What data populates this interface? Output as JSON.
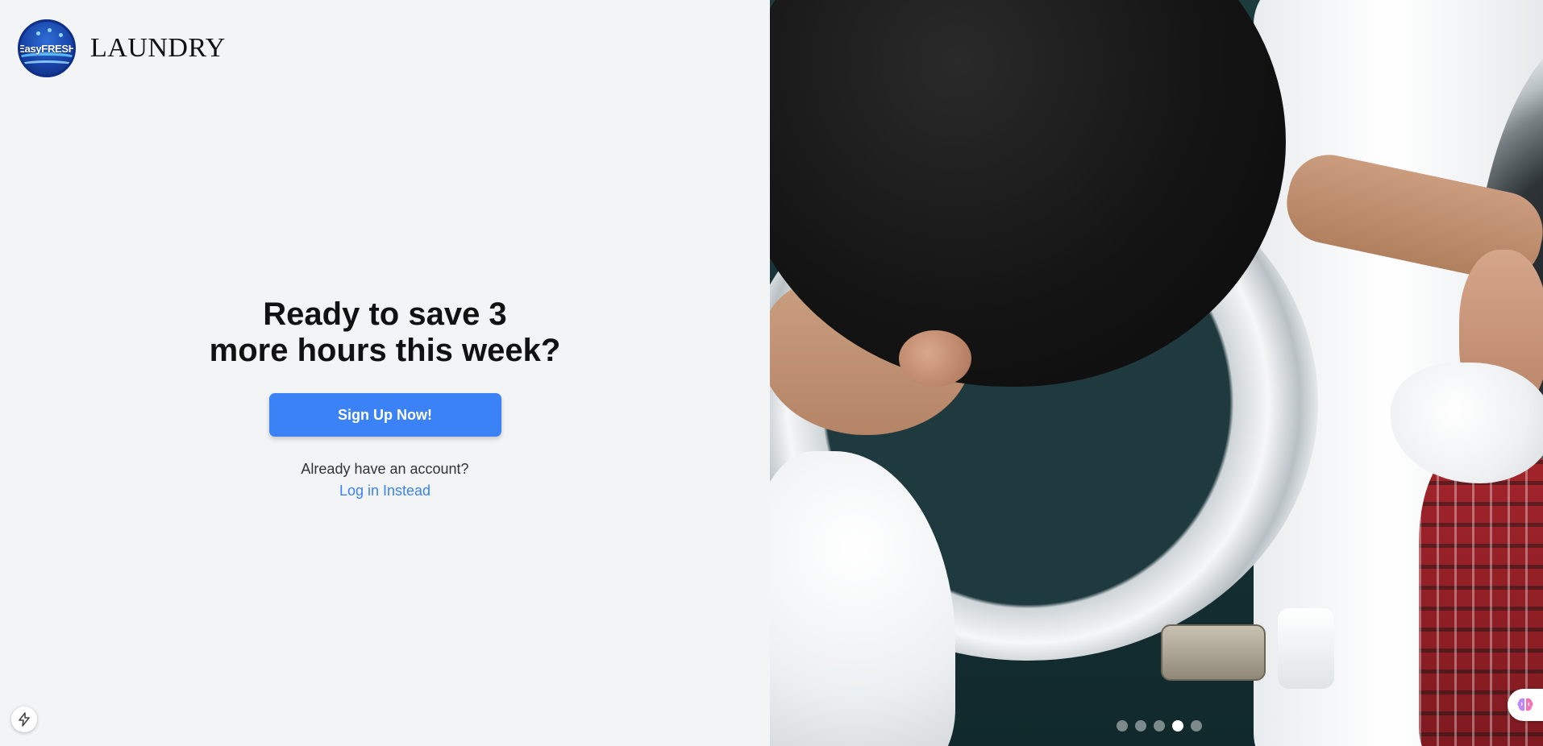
{
  "brand": {
    "badge_text": "EasyFRESH",
    "name": "LAUNDRY"
  },
  "hero": {
    "headline_line1": "Ready to save 3",
    "headline_line2": "more hours this week?",
    "cta_label": "Sign Up Now!",
    "already_text": "Already have an account?",
    "login_label": "Log in Instead"
  },
  "carousel": {
    "slide_count": 5,
    "active_index": 3
  },
  "icons": {
    "bottom_left": "lightning-bolt-icon",
    "bottom_right": "brain-icon"
  },
  "colors": {
    "accent": "#3b82f6",
    "left_background": "#f3f4f6",
    "heading": "#111111"
  }
}
